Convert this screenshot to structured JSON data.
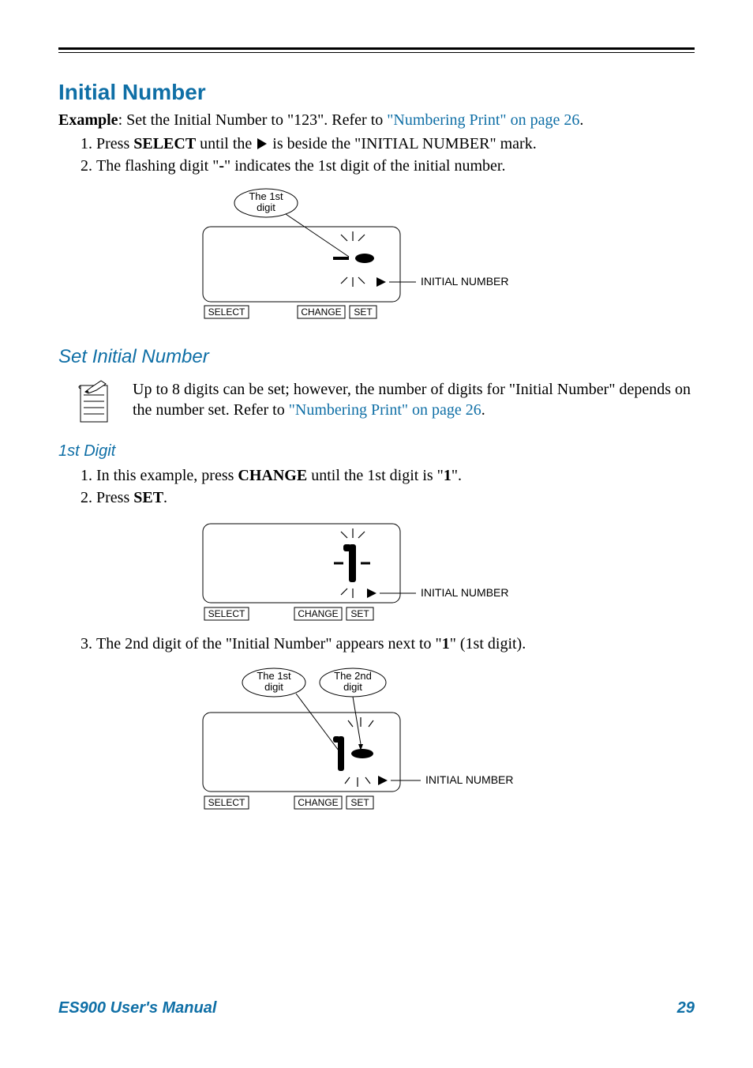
{
  "section": {
    "title": "Initial Number",
    "example_label": "Example",
    "example_text": ": Set the Initial Number to \"123\". Refer to ",
    "example_link": "\"Numbering Print\" on page 26",
    "example_end": ".",
    "steps_top": [
      {
        "pre": "Press ",
        "bold": "SELECT",
        "mid": " until the ",
        "post": " is beside the \"INITIAL NUMBER\" mark."
      },
      {
        "pre": "The flashing digit \"",
        "bold": "-",
        "post": "\" indicates the 1st digit of the initial number."
      }
    ]
  },
  "diagram1": {
    "callout": "The 1st\ndigit",
    "side_label": "INITIAL NUMBER",
    "buttons": [
      "SELECT",
      "CHANGE",
      "SET"
    ]
  },
  "subsection": {
    "title": "Set Initial Number",
    "note_pre": "Up to 8 digits can be set; however, the number of digits for \"Initial Number\" depends on the number set. Refer to ",
    "note_link": "\"Numbering Print\" on page 26",
    "note_end": "."
  },
  "first_digit": {
    "title": "1st Digit",
    "steps_a": [
      {
        "pre": "In this example, press ",
        "bold": "CHANGE",
        "mid": " until the 1st digit is \"",
        "bold2": "1",
        "post": "\"."
      },
      {
        "pre": "Press ",
        "bold": "SET",
        "post": "."
      }
    ],
    "step3_pre": "The 2nd digit of the \"Initial Number\" appears next to \"",
    "step3_bold": "1",
    "step3_post": "\" (1st digit)."
  },
  "diagram2": {
    "side_label": "INITIAL NUMBER",
    "buttons": [
      "SELECT",
      "CHANGE",
      "SET"
    ]
  },
  "diagram3": {
    "callout1": "The 1st\ndigit",
    "callout2": "The 2nd\ndigit",
    "side_label": "INITIAL NUMBER",
    "buttons": [
      "SELECT",
      "CHANGE",
      "SET"
    ]
  },
  "footer": {
    "manual": "ES900 User's Manual",
    "page": "29"
  }
}
